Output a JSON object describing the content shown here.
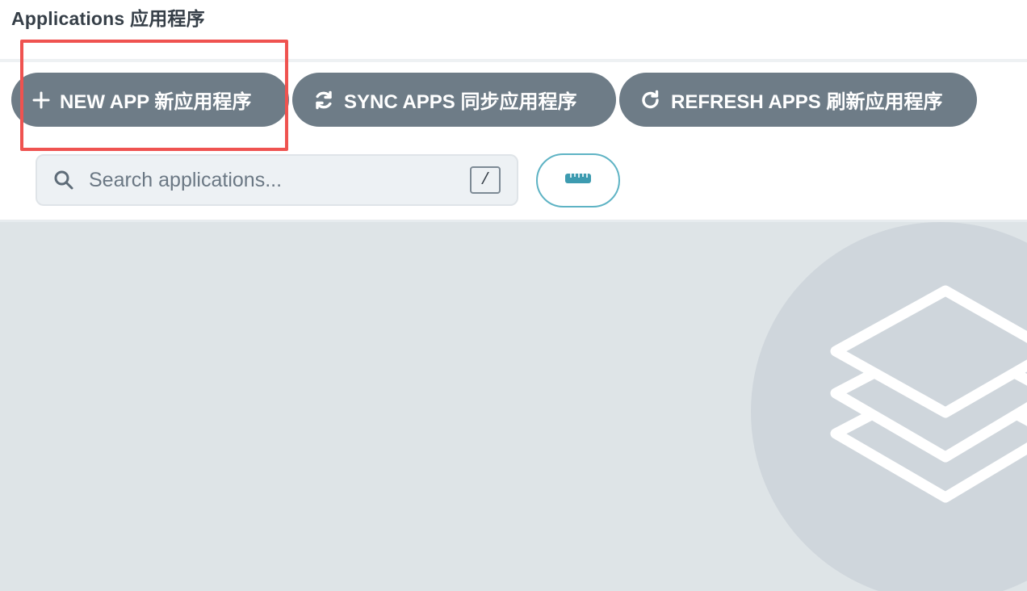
{
  "header": {
    "title": "Applications 应用程序"
  },
  "toolbar": {
    "new_app_label": "NEW APP 新应用程序",
    "sync_apps_label": "SYNC APPS 同步应用程序",
    "refresh_apps_label": "REFRESH APPS 刷新应用程序"
  },
  "search": {
    "placeholder": "Search applications...",
    "value": "",
    "shortcut_key": "/"
  },
  "icons": {
    "new_app": "plus-icon",
    "sync_apps": "sync-icon",
    "refresh_apps": "refresh-icon",
    "search": "search-icon",
    "view_toggle": "ruler-icon",
    "empty_state": "layers-icon"
  },
  "colors": {
    "button_bg": "#6e7c87",
    "highlight": "#ef5350",
    "accent": "#5eb3c4",
    "content_bg": "#dee4e7"
  }
}
